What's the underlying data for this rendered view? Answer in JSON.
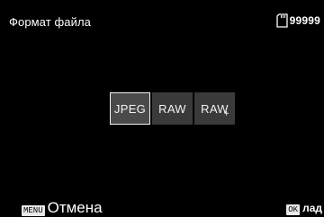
{
  "header": {
    "title": "Формат файла",
    "remaining_shots": "99999",
    "storage_icon": "sd-card-icon"
  },
  "options": [
    {
      "label": "JPEG",
      "selected": true
    },
    {
      "label": "RAW",
      "selected": false
    },
    {
      "label": "RAW",
      "suffix": "+",
      "selected": false
    }
  ],
  "footer": {
    "menu_key": "MENU",
    "cancel_label": "Отмена",
    "ok_key": "OK",
    "ok_label": "лад"
  }
}
